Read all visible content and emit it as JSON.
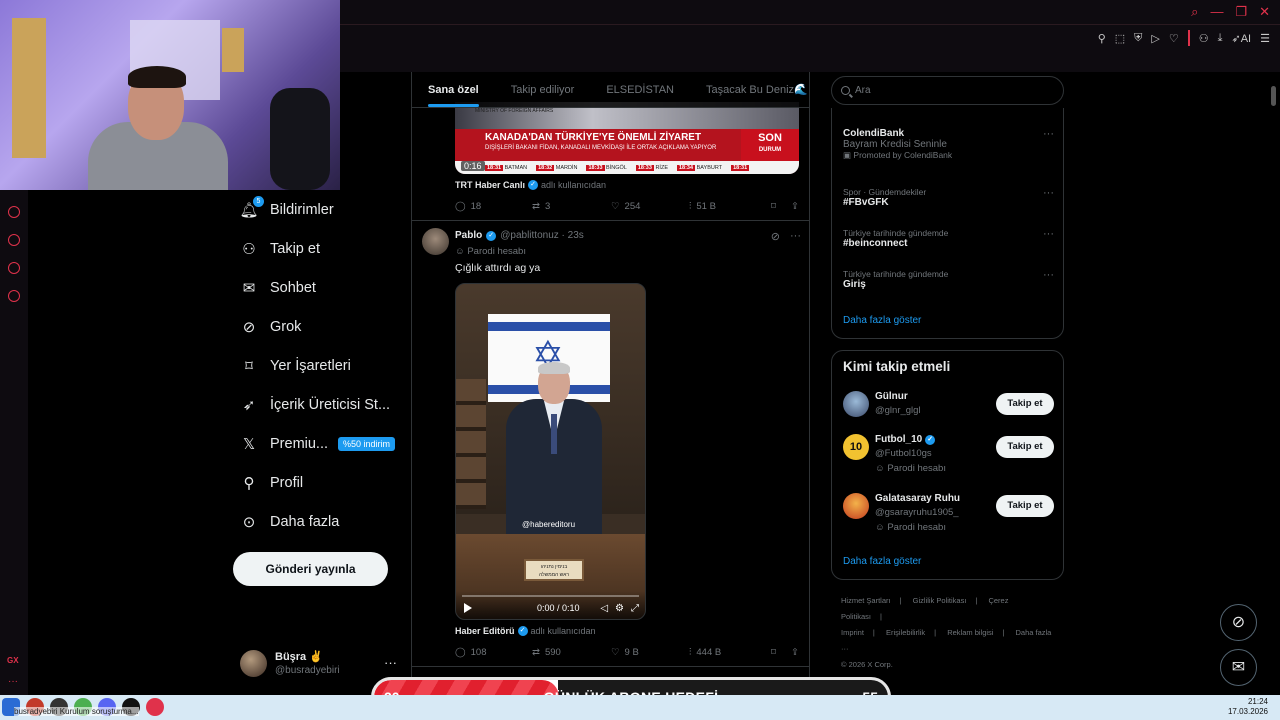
{
  "window": {
    "ai_label": "AI"
  },
  "nav": {
    "items": [
      {
        "label": "Bildirimler",
        "icon": "bell-icon",
        "badge": "5"
      },
      {
        "label": "Takip et",
        "icon": "add-person-icon"
      },
      {
        "label": "Sohbet",
        "icon": "envelope-icon"
      },
      {
        "label": "Grok",
        "icon": "grok-icon"
      },
      {
        "label": "Yer İşaretleri",
        "icon": "bookmark-icon"
      },
      {
        "label": "İçerik Üreticisi St...",
        "icon": "rocket-icon"
      },
      {
        "label": "Premiu...",
        "icon": "x-logo-icon",
        "promo": "%50 indirim"
      },
      {
        "label": "Profil",
        "icon": "person-icon"
      },
      {
        "label": "Daha fazla",
        "icon": "more-circle-icon"
      }
    ],
    "post_button": "Gönderi yayınla",
    "user": {
      "name": "Büşra ✌️",
      "handle": "@busradyebiri"
    }
  },
  "tabs": [
    "Sana özel",
    "Takip ediliyor",
    "ELSEDİSTAN",
    "Taşacak Bu Deniz🌊"
  ],
  "tweet1": {
    "thumb": {
      "ministry": "MINISTRY OF FOREIGN AFFAIRS",
      "headline": "KANADA'DAN TÜRKİYE'YE ÖNEMLİ ZİYARET",
      "sub": "DIŞİŞLERİ BAKANI FİDAN, KANADALI MEVKİDAŞI İLE ORTAK AÇIKLAMA YAPIYOR",
      "son1": "SON",
      "son2": "DURUM",
      "time": "0:16",
      "ticker": [
        {
          "t": "18:31",
          "c": "BATMAN"
        },
        {
          "t": "18:32",
          "c": "MARDİN"
        },
        {
          "t": "18:33",
          "c": "BİNGÖL"
        },
        {
          "t": "18:33",
          "c": "RİZE"
        },
        {
          "t": "18:34",
          "c": "BAYBURT"
        },
        {
          "t": "18:31",
          "c": ""
        }
      ]
    },
    "credit_name": "TRT Haber Canlı",
    "credit_suffix": "adlı kullanıcıdan",
    "stats": {
      "replies": "18",
      "reposts": "3",
      "likes": "254",
      "views": "51 B"
    }
  },
  "tweet2": {
    "name": "Pablo",
    "handle": "@pablittonuz · 23s",
    "parody": "Parodi hesabı",
    "text": "Çığlık attırdı ag ya",
    "video": {
      "watermark": "@habereditoru",
      "plate": "בנימין נתניהו",
      "plate2": "ראש הממשלה",
      "time": "0:00 / 0:10"
    },
    "credit_name": "Haber Editörü",
    "credit_suffix": "adlı kullanıcıdan",
    "stats": {
      "replies": "108",
      "reposts": "590",
      "likes": "9 B",
      "views": "444 B"
    }
  },
  "search": {
    "placeholder": "Ara"
  },
  "trends": [
    {
      "title": "ColendiBank",
      "sub": "Bayram Kredisi Seninle",
      "promo": "Promoted by ColendiBank"
    },
    {
      "context": "Spor · Gündemdekiler",
      "title": "#FBvGFK"
    },
    {
      "context": "Türkiye tarihinde gündemde",
      "title": "#beinconnect"
    },
    {
      "context": "Türkiye tarihinde gündemde",
      "title": "Giriş"
    }
  ],
  "trends_more": "Daha fazla göster",
  "who_to_follow": {
    "title": "Kimi takip etmeli",
    "users": [
      {
        "name": "Gülnur",
        "handle": "@glnr_glgl",
        "verified": false,
        "parody": ""
      },
      {
        "name": "Futbol_10",
        "handle": "@Futbol10gs",
        "verified": true,
        "parody": "Parodi hesabı"
      },
      {
        "name": "Galatasaray Ruhu",
        "handle": "@gsarayruhu1905_",
        "verified": false,
        "parody": "Parodi hesabı"
      }
    ],
    "follow_label": "Takip et",
    "more": "Daha fazla göster"
  },
  "footer": {
    "links": [
      "Hizmet Şartları",
      "|",
      "Gizlilik Politikası",
      "|",
      "Çerez Politikası",
      "|",
      "Imprint",
      "|",
      "Erişilebilirlik",
      "|",
      "Reklam bilgisi",
      "|",
      "Daha fazla ···"
    ],
    "copyright": "© 2026 X Corp."
  },
  "goal": {
    "current": "20",
    "label": "GÜNLÜK ABONE HEDEFİ",
    "target": "55",
    "progress": 0.36
  },
  "taskbar": {
    "text": "busradyebiri  Kurulum soruşturma...",
    "time": "21:24",
    "date": "17.03.2026"
  },
  "colors": {
    "accent": "#1d9bf0",
    "gx_red": "#e0324b",
    "goal_red": "#e1202e"
  }
}
